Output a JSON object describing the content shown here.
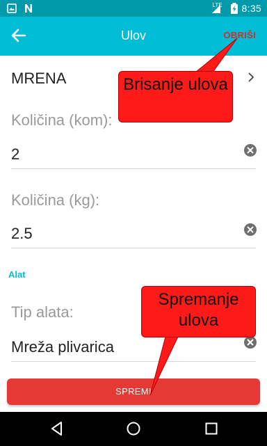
{
  "status_bar": {
    "time": "8:35",
    "network": "LTE",
    "battery": "battery-charging-icon"
  },
  "toolbar": {
    "title": "Ulov",
    "delete_label": "OBRIŠI",
    "back_icon": "back-arrow-icon"
  },
  "form": {
    "species": "MRENA",
    "quantity_pcs_label": "Količina (kom):",
    "quantity_pcs_value": "2",
    "quantity_kg_label": "Količina (kg):",
    "quantity_kg_value": "2.5",
    "section_tool": "Alat",
    "tool_type_label": "Tip alata:",
    "tool_type_value": "Mreža plivarica"
  },
  "save_label": "SPREMI",
  "callouts": {
    "delete_note": "Brisanje ulova",
    "save_note": "Spremanje ulova"
  },
  "colors": {
    "accent": "#00bcd4",
    "status_bar": "#009aab",
    "save_button": "#e53935",
    "delete_text": "#d32f2f",
    "callout": "#ff1a1a"
  }
}
